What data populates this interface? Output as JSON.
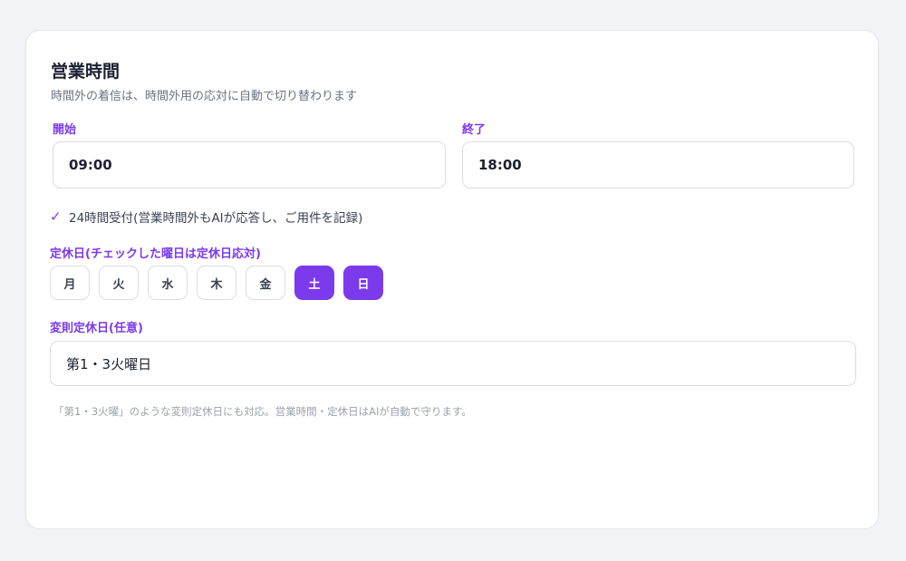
{
  "hours": {
    "title": "営業時間",
    "subtitle": "時間外の着信は、時間外用の応対に自動で切り替わります",
    "start_label": "開始",
    "start_value": "09:00",
    "end_label": "終了",
    "end_value": "18:00",
    "always_open": {
      "checked": true,
      "icon": "checkmark-icon",
      "label": "24時間受付(営業時間外もAIが応答し、ご用件を記録)"
    },
    "holidays_label": "定休日(チェックした曜日は定休日応対)",
    "days": [
      {
        "label": "月",
        "selected": false
      },
      {
        "label": "火",
        "selected": false
      },
      {
        "label": "水",
        "selected": false
      },
      {
        "label": "木",
        "selected": false
      },
      {
        "label": "金",
        "selected": false
      },
      {
        "label": "土",
        "selected": true
      },
      {
        "label": "日",
        "selected": true
      }
    ],
    "irregular_label": "変則定休日(任意)",
    "irregular_value": "第1・3火曜日",
    "note": "「第1・3火曜」のような変則定休日にも対応。営業時間・定休日はAIが自動で守ります。"
  },
  "colors": {
    "accent": "#7c3aed",
    "background": "#f1f3f7",
    "card": "#ffffff"
  }
}
